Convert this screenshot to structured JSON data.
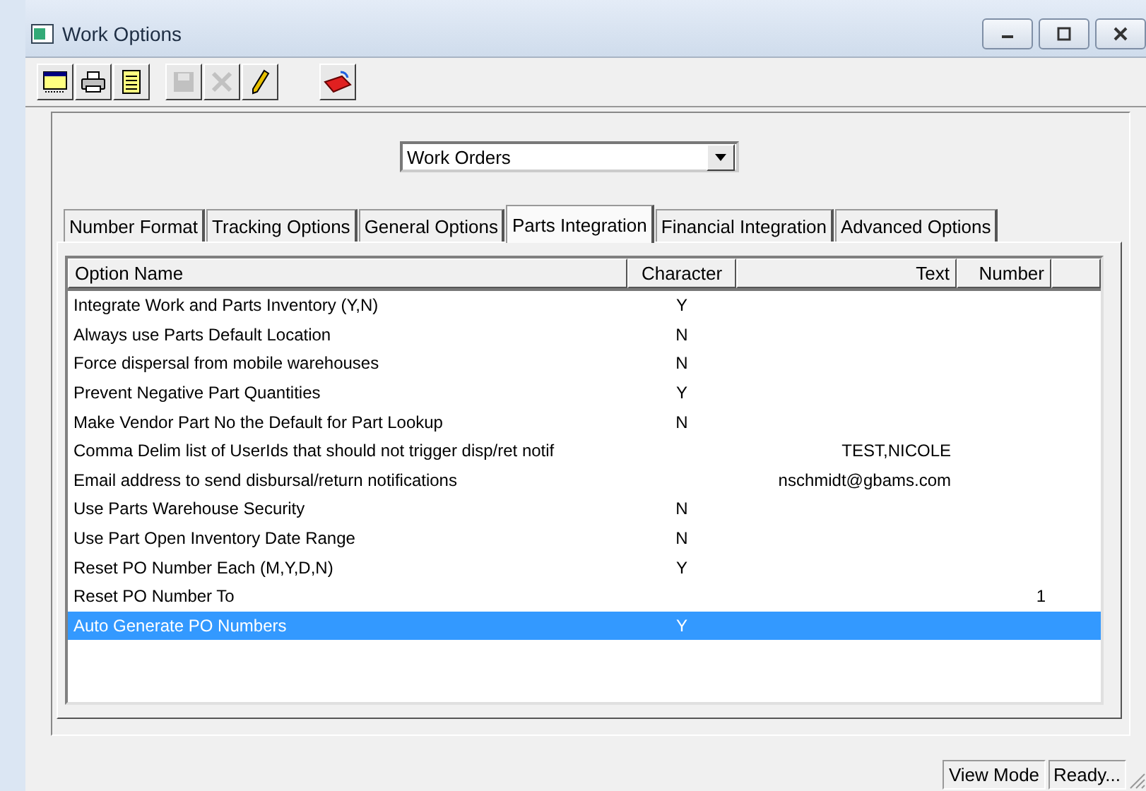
{
  "window": {
    "title": "Work Options"
  },
  "toolbar": [
    {
      "kind": "window",
      "disabled": false
    },
    {
      "kind": "print",
      "disabled": false
    },
    {
      "kind": "document",
      "disabled": false
    },
    {
      "kind": "save",
      "disabled": true
    },
    {
      "kind": "delete",
      "disabled": true
    },
    {
      "kind": "edit",
      "disabled": false
    },
    {
      "kind": "exit",
      "disabled": false
    }
  ],
  "module_select": {
    "value": "Work Orders"
  },
  "tabs": [
    {
      "label": "Number Format",
      "selected": false
    },
    {
      "label": "Tracking Options",
      "selected": false
    },
    {
      "label": "General Options",
      "selected": false
    },
    {
      "label": "Parts Integration",
      "selected": true
    },
    {
      "label": "Financial Integration",
      "selected": false
    },
    {
      "label": "Advanced Options",
      "selected": false
    }
  ],
  "table": {
    "columns": [
      "Option Name",
      "Character",
      "Text",
      "Number"
    ],
    "rows": [
      {
        "name": "Integrate Work and Parts Inventory (Y,N)",
        "character": "Y",
        "selected": false
      },
      {
        "name": "Always use Parts Default Location",
        "character": "N",
        "selected": false
      },
      {
        "name": "Force dispersal from mobile warehouses",
        "character": "N",
        "selected": false
      },
      {
        "name": "Prevent Negative Part Quantities",
        "character": "Y",
        "selected": false
      },
      {
        "name": "Make Vendor Part No the Default for Part Lookup",
        "character": "N",
        "selected": false
      },
      {
        "name": "Comma Delim list of UserIds that should not trigger disp/ret notif",
        "text": "TEST,NICOLE",
        "selected": false
      },
      {
        "name": "Email address to send disbursal/return notifications",
        "text": "nschmidt@gbams.com",
        "selected": false
      },
      {
        "name": "Use Parts Warehouse Security",
        "character": "N",
        "selected": false
      },
      {
        "name": "Use Part Open Inventory Date Range",
        "character": "N",
        "selected": false
      },
      {
        "name": "Reset PO Number Each (M,Y,D,N)",
        "character": "Y",
        "selected": false
      },
      {
        "name": "Reset PO Number To",
        "number": "1",
        "selected": false
      },
      {
        "name": "Auto Generate PO Numbers",
        "character": "Y",
        "selected": true
      }
    ]
  },
  "status_bar": [
    "View Mode",
    "Ready..."
  ]
}
